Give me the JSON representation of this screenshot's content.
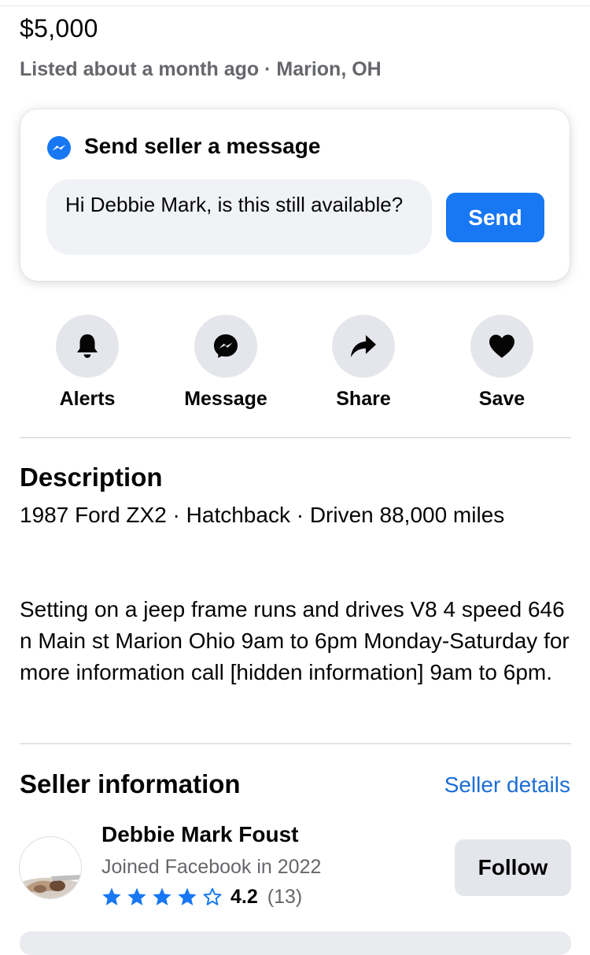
{
  "listing": {
    "price": "$5,000",
    "meta": "Listed about a month ago · Marion, OH"
  },
  "message_card": {
    "title": "Send seller a message",
    "input_value": "Hi Debbie Mark, is this still available?",
    "send_label": "Send",
    "icon": "messenger-icon"
  },
  "actions": [
    {
      "label": "Alerts",
      "icon": "bell-icon"
    },
    {
      "label": "Message",
      "icon": "messenger-icon"
    },
    {
      "label": "Share",
      "icon": "share-arrow-icon"
    },
    {
      "label": "Save",
      "icon": "heart-icon"
    }
  ],
  "description": {
    "heading": "Description",
    "summary": "1987 Ford ZX2 · Hatchback · Driven 88,000 miles",
    "body": "Setting on a jeep frame runs and drives V8 4 speed 646 n Main st Marion Ohio 9am to 6pm Monday-Saturday for more information call [hidden information] 9am to 6pm."
  },
  "seller": {
    "heading": "Seller information",
    "details_link": "Seller details",
    "name": "Debbie Mark Foust",
    "joined": "Joined Facebook in 2022",
    "rating": "4.2",
    "rating_count": "(13)",
    "stars_filled": 4,
    "stars_total": 5,
    "follow_label": "Follow"
  },
  "colors": {
    "accent": "#1877f2",
    "link": "#1b6ed4",
    "secondary_text": "#65676b",
    "button_gray": "#e4e6eb"
  }
}
